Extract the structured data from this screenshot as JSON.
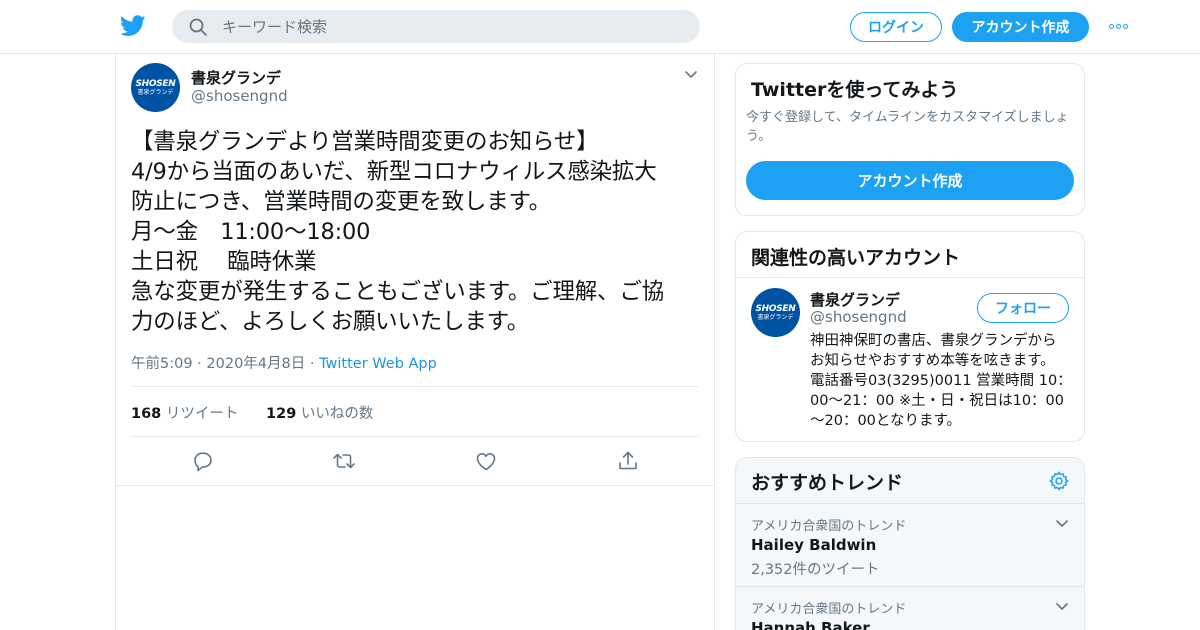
{
  "colors": {
    "accent": "#1da1f2",
    "border": "#e1e8ed",
    "muted": "#657786",
    "text": "#14171a",
    "brand_avatar": "#0052a3"
  },
  "header": {
    "logo_icon": "twitter-bird-icon",
    "search": {
      "icon": "search-icon",
      "placeholder": "キーワード検索",
      "value": ""
    },
    "login_label": "ログイン",
    "signup_label": "アカウント作成",
    "more_icon": "more-dots-icon"
  },
  "tweet": {
    "author": {
      "name": "書泉グランデ",
      "handle": "@shosengnd",
      "avatar_line1": "SHOSEN",
      "avatar_line2": "書泉グランデ"
    },
    "lines": [
      "【書泉グランデより営業時間変更のお知らせ】",
      "4/9から当面のあいだ、新型コロナウィルス感染拡大",
      "防止につき、営業時間の変更を致します。",
      "月〜金　11:00〜18:00",
      "土日祝　 臨時休業",
      "急な変更が発生することもございます。ご理解、ご協",
      "力のほど、よろしくお願いいたします。"
    ],
    "time": "午前5:09 · 2020年4月8日",
    "sep": " · ",
    "source": "Twitter Web App",
    "retweets": {
      "count": "168",
      "label": "リツイート"
    },
    "likes": {
      "count": "129",
      "label": "いいねの数"
    },
    "actions": [
      "reply-icon",
      "retweet-icon",
      "like-icon",
      "share-icon"
    ]
  },
  "signup_card": {
    "title": "Twitterを使ってみよう",
    "description": "今すぐ登録して、タイムラインをカスタマイズしましょう。",
    "button_label": "アカウント作成"
  },
  "related": {
    "title": "関連性の高いアカウント",
    "account": {
      "name": "書泉グランデ",
      "handle": "@shosengnd",
      "follow_label": "フォロー",
      "bio_lines": [
        "神田神保町の書店、書泉グランデから",
        "お知らせやおすすめ本等を呟きます。",
        "電話番号03(3295)0011 営業時間 10：",
        "00～21：00 ※土・日・祝日は10：00",
        "～20：00となります。"
      ]
    }
  },
  "trends": {
    "title": "おすすめトレンド",
    "settings_icon": "gear-icon",
    "items": [
      {
        "context": "アメリカ合衆国のトレンド",
        "name": "Hailey Baldwin",
        "count": "2,352件のツイート"
      },
      {
        "context": "アメリカ合衆国のトレンド",
        "name": "Hannah Baker",
        "count": ""
      }
    ]
  }
}
